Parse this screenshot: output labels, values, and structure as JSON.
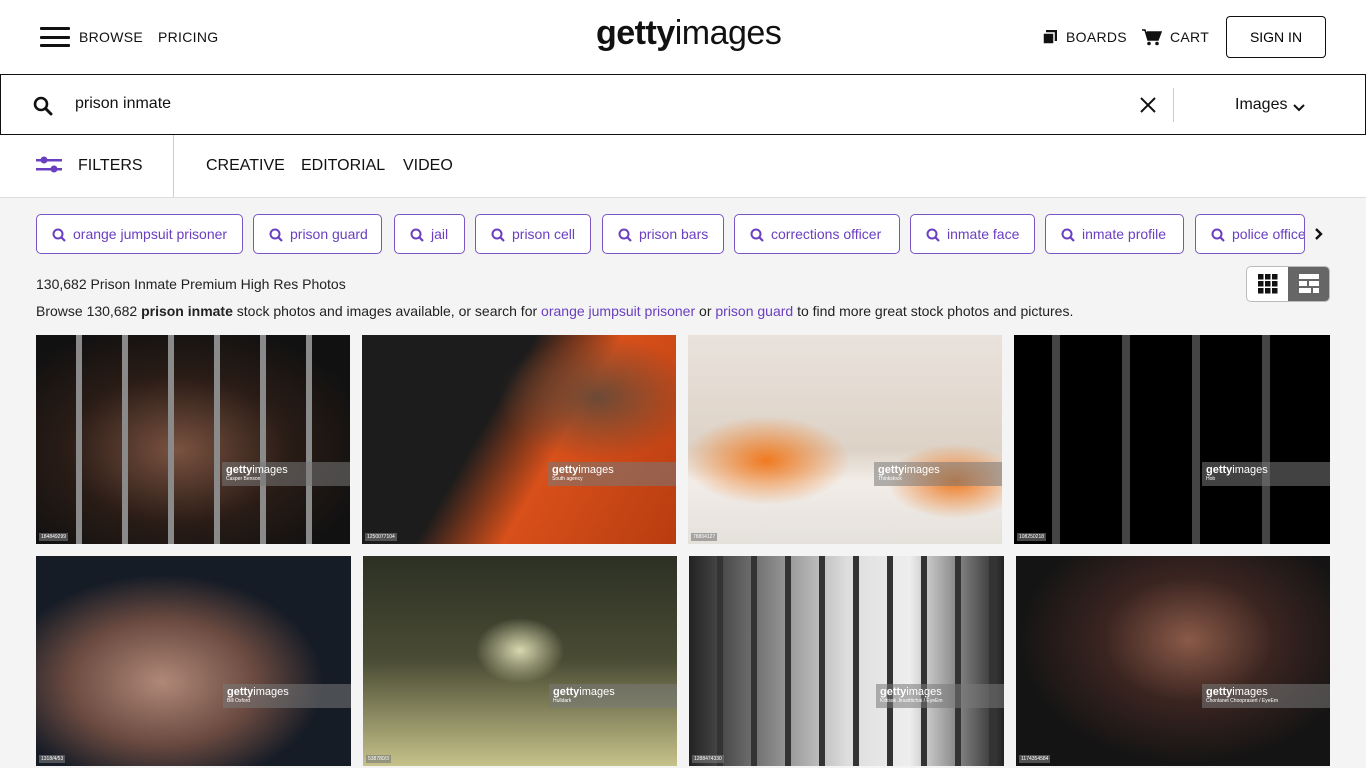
{
  "header": {
    "browse": "BROWSE",
    "pricing": "PRICING",
    "logo": "gettyimages",
    "logo_bold": "getty",
    "logo_light": "images",
    "boards": "BOARDS",
    "cart": "CART",
    "sign_in": "SIGN IN"
  },
  "search": {
    "query": "prison inmate",
    "type": "Images"
  },
  "filters": {
    "label": "FILTERS",
    "tabs": [
      "CREATIVE",
      "EDITORIAL",
      "VIDEO"
    ]
  },
  "chips": [
    "orange jumpsuit prisoner",
    "prison guard",
    "jail",
    "prison cell",
    "prison bars",
    "corrections officer",
    "inmate face",
    "inmate profile",
    "police officer"
  ],
  "results": {
    "count_text": "130,682 Prison Inmate Premium High Res Photos",
    "desc_pre": "Browse 130,682 ",
    "desc_bold": "prison inmate",
    "desc_mid": " stock photos and images available, or search for ",
    "link1": "orange jumpsuit prisoner",
    "desc_or": " or ",
    "link2": "prison guard",
    "desc_post": " to find more great stock photos and pictures."
  },
  "view_toggle": {
    "options": [
      "grid-view",
      "mosaic-view"
    ],
    "active": "mosaic-view"
  },
  "colors": {
    "accent": "#6a3fc0"
  },
  "images": [
    {
      "credit": "Casper Benson",
      "id": "184849299"
    },
    {
      "credit": "South agency",
      "id": "1250077104"
    },
    {
      "credit": "Thinkstock",
      "id": "78804127"
    },
    {
      "credit": "Hob",
      "id": "108250218"
    },
    {
      "credit": "Bill Oxford",
      "id": "1318/4/53"
    },
    {
      "credit": "Hulldark",
      "id": "538780/3"
    },
    {
      "credit": "Kittisak Jirasittichai / EyeEm",
      "id": "1288474330"
    },
    {
      "credit": "Chonlanet Chooprasert / EyeEm",
      "id": "1174354584"
    }
  ]
}
